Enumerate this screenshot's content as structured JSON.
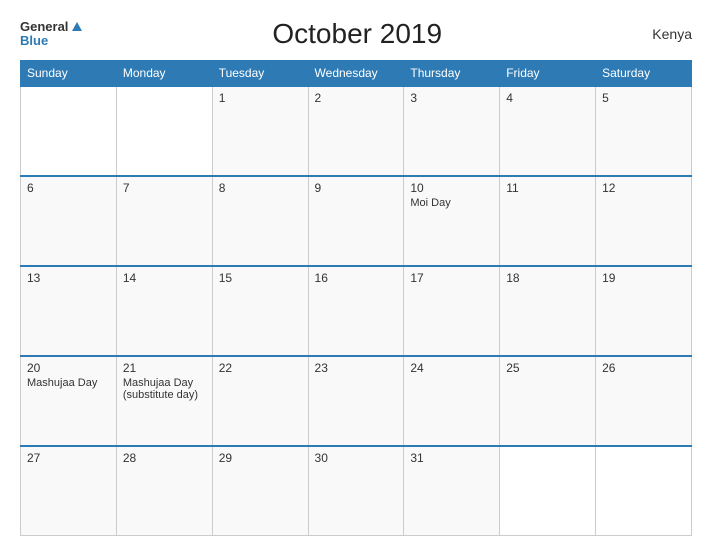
{
  "header": {
    "logo_general": "General",
    "logo_blue": "Blue",
    "title": "October 2019",
    "country": "Kenya"
  },
  "weekdays": [
    "Sunday",
    "Monday",
    "Tuesday",
    "Wednesday",
    "Thursday",
    "Friday",
    "Saturday"
  ],
  "weeks": [
    [
      {
        "day": "",
        "event": ""
      },
      {
        "day": "",
        "event": ""
      },
      {
        "day": "1",
        "event": ""
      },
      {
        "day": "2",
        "event": ""
      },
      {
        "day": "3",
        "event": ""
      },
      {
        "day": "4",
        "event": ""
      },
      {
        "day": "5",
        "event": ""
      }
    ],
    [
      {
        "day": "6",
        "event": ""
      },
      {
        "day": "7",
        "event": ""
      },
      {
        "day": "8",
        "event": ""
      },
      {
        "day": "9",
        "event": ""
      },
      {
        "day": "10",
        "event": "Moi Day"
      },
      {
        "day": "11",
        "event": ""
      },
      {
        "day": "12",
        "event": ""
      }
    ],
    [
      {
        "day": "13",
        "event": ""
      },
      {
        "day": "14",
        "event": ""
      },
      {
        "day": "15",
        "event": ""
      },
      {
        "day": "16",
        "event": ""
      },
      {
        "day": "17",
        "event": ""
      },
      {
        "day": "18",
        "event": ""
      },
      {
        "day": "19",
        "event": ""
      }
    ],
    [
      {
        "day": "20",
        "event": "Mashujaa Day"
      },
      {
        "day": "21",
        "event": "Mashujaa Day (substitute day)"
      },
      {
        "day": "22",
        "event": ""
      },
      {
        "day": "23",
        "event": ""
      },
      {
        "day": "24",
        "event": ""
      },
      {
        "day": "25",
        "event": ""
      },
      {
        "day": "26",
        "event": ""
      }
    ],
    [
      {
        "day": "27",
        "event": ""
      },
      {
        "day": "28",
        "event": ""
      },
      {
        "day": "29",
        "event": ""
      },
      {
        "day": "30",
        "event": ""
      },
      {
        "day": "31",
        "event": ""
      },
      {
        "day": "",
        "event": ""
      },
      {
        "day": "",
        "event": ""
      }
    ]
  ]
}
